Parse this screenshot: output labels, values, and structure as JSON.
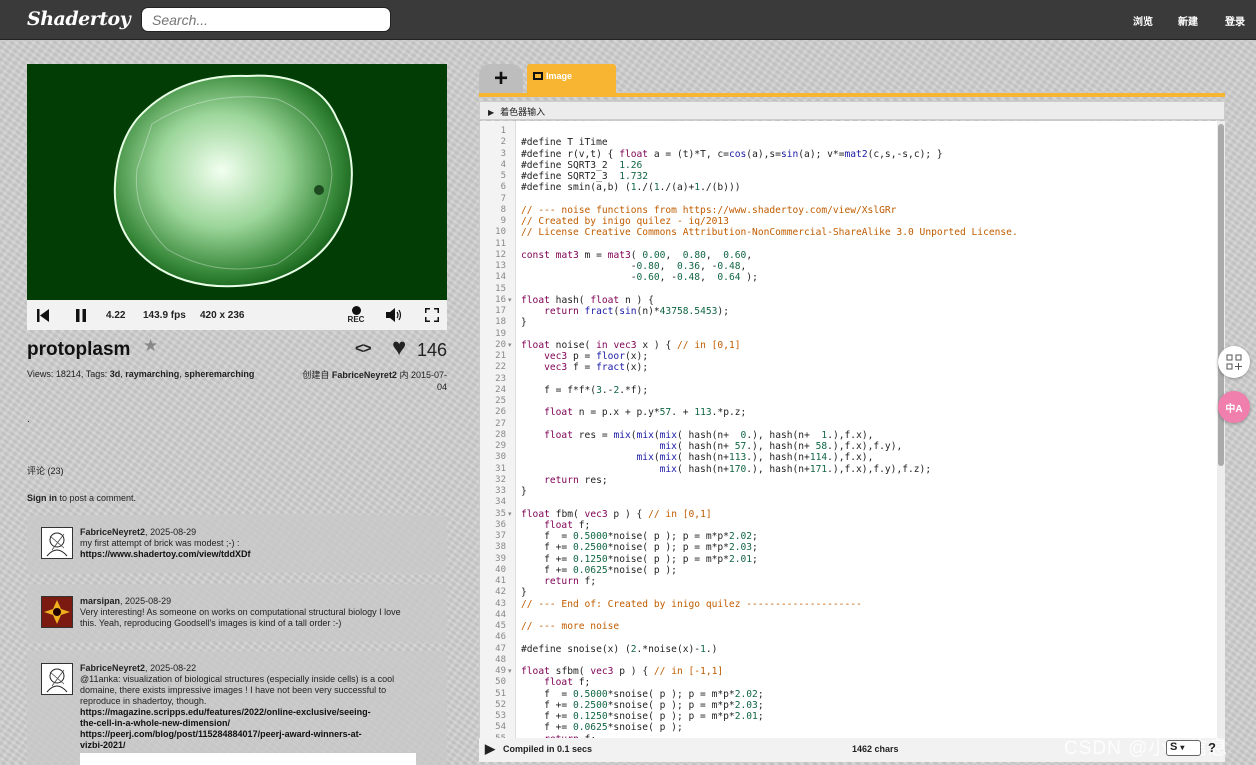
{
  "nav": {
    "logo": "Shadertoy",
    "search_placeholder": "Search...",
    "browse": "浏览",
    "new": "新建",
    "login": "登录"
  },
  "player": {
    "time": "4.22",
    "fps": "143.9 fps",
    "resolution": "420 x 236",
    "rec": "REC"
  },
  "shader": {
    "title": "protoplasm",
    "likes": "146",
    "views_label": "Views: 18214, Tags:",
    "tags": [
      "3d",
      "raymarching",
      "spheremarching"
    ],
    "created_by_prefix": "创建自",
    "author": "FabriceNeyret2",
    "created_in": "内 2015-07-04",
    "description": "."
  },
  "comments": {
    "header": "评论 (23)",
    "signin": "Sign in",
    "signin_suffix": " to post a comment.",
    "items": [
      {
        "user": "FabriceNeyret2",
        "date": "2025-08-29",
        "lines": [
          "my first attempt of brick was modest ;-) :"
        ],
        "links": [
          "https://www.shadertoy.com/view/tddXDf"
        ]
      },
      {
        "user": "marsipan",
        "date": "2025-08-29",
        "lines": [
          "Very interesting! As someone on works on computational structural biology I love",
          "this. Yeah, reproducing Goodsell's  images is kind of a tall order :-)"
        ],
        "links": []
      },
      {
        "user": "FabriceNeyret2",
        "date": "2025-08-22",
        "lines": [
          "@11anka: visualization of biological structures (especially inside cells) is a cool",
          "domaine, there exists impressive images ! I have not been very successful to",
          "reproduce in shadertoy, though."
        ],
        "links": [
          "https://magazine.scripps.edu/features/2022/online-exclusive/seeing-",
          "the-cell-in-a-whole-new-dimension/",
          "https://peerj.com/blog/post/115284884017/peerj-award-winners-at-",
          "vizbi-2021/"
        ]
      }
    ]
  },
  "editor": {
    "tab_plus": "+",
    "tab_image": "Image",
    "inputs_label": "着色器输入",
    "status": "Compiled in 0.1 secs",
    "chars": "1462 chars",
    "select_value": "S",
    "help": "?",
    "code": [
      "",
      "#define T iTime",
      "#define r(v,t) { float a = (t)*T, c=cos(a),s=sin(a); v*=mat2(c,s,-s,c); }",
      "#define SQRT3_2  1.26",
      "#define SQRT2_3  1.732",
      "#define smin(a,b) (1./(1./(a)+1./(b)))",
      "",
      "// --- noise functions from https://www.shadertoy.com/view/XslGRr",
      "// Created by inigo quilez - iq/2013",
      "// License Creative Commons Attribution-NonCommercial-ShareAlike 3.0 Unported License.",
      "",
      "const mat3 m = mat3( 0.00,  0.80,  0.60,",
      "                   -0.80,  0.36, -0.48,",
      "                   -0.60, -0.48,  0.64 );",
      "",
      "float hash( float n ) {",
      "    return fract(sin(n)*43758.5453);",
      "}",
      "",
      "float noise( in vec3 x ) { // in [0,1]",
      "    vec3 p = floor(x);",
      "    vec3 f = fract(x);",
      "",
      "    f = f*f*(3.-2.*f);",
      "",
      "    float n = p.x + p.y*57. + 113.*p.z;",
      "",
      "    float res = mix(mix(mix( hash(n+  0.), hash(n+  1.),f.x),",
      "                        mix( hash(n+ 57.), hash(n+ 58.),f.x),f.y),",
      "                    mix(mix( hash(n+113.), hash(n+114.),f.x),",
      "                        mix( hash(n+170.), hash(n+171.),f.x),f.y),f.z);",
      "    return res;",
      "}",
      "",
      "float fbm( vec3 p ) { // in [0,1]",
      "    float f;",
      "    f  = 0.5000*noise( p ); p = m*p*2.02;",
      "    f += 0.2500*noise( p ); p = m*p*2.03;",
      "    f += 0.1250*noise( p ); p = m*p*2.01;",
      "    f += 0.0625*noise( p );",
      "    return f;",
      "}",
      "// --- End of: Created by inigo quilez --------------------",
      "",
      "// --- more noise",
      "",
      "#define snoise(x) (2.*noise(x)-1.)",
      "",
      "float sfbm( vec3 p ) { // in [-1,1]",
      "    float f;",
      "    f  = 0.5000*snoise( p ); p = m*p*2.02;",
      "    f += 0.2500*snoise( p ); p = m*p*2.03;",
      "    f += 0.1250*snoise( p ); p = m*p*2.01;",
      "    f += 0.0625*snoise( p );",
      "    return f;"
    ],
    "fold_lines": [
      16,
      20,
      35,
      49
    ]
  },
  "watermark": "CSDN @小一信息",
  "colors": {
    "keyword": "#7f0055",
    "type": "#7f0055",
    "number": "#116644",
    "comment": "#c05c00",
    "function": "#1a1aa6",
    "accent": "#f7b532"
  }
}
